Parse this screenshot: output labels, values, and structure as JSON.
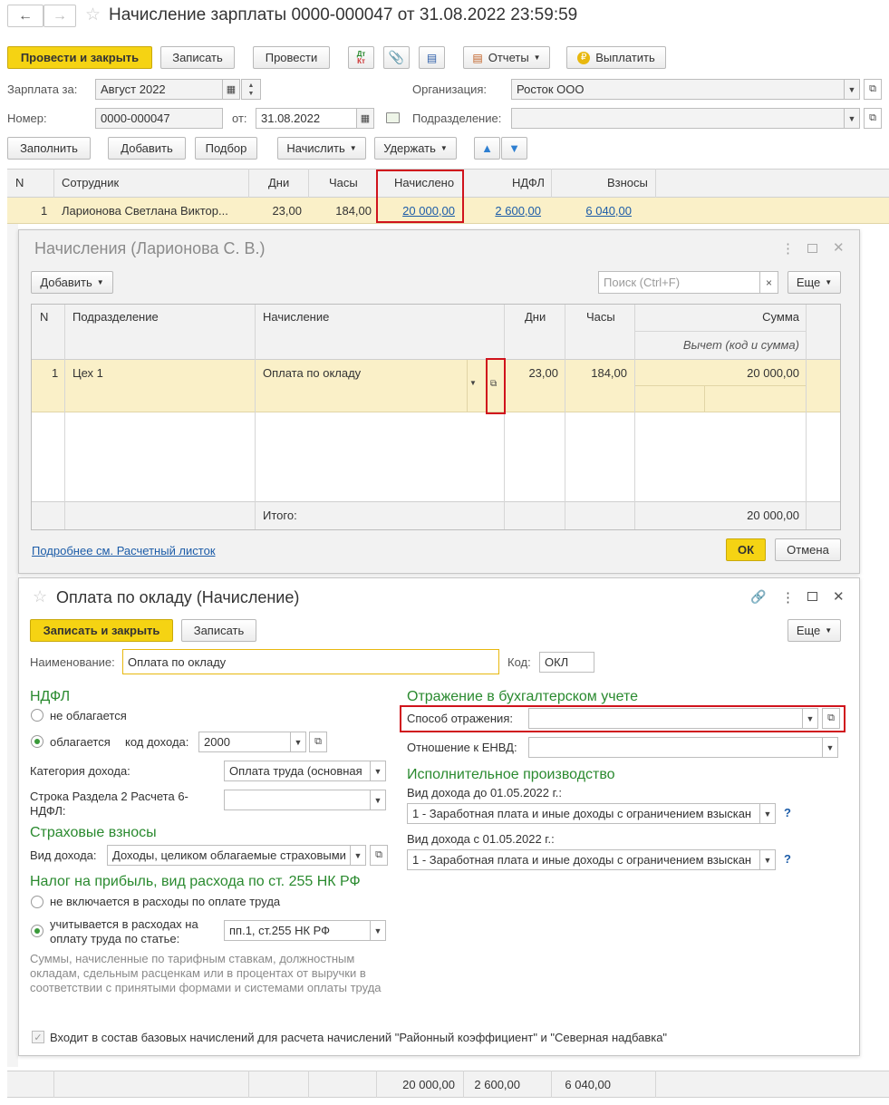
{
  "doc": {
    "title": "Начисление зарплаты 0000-000047 от 31.08.2022 23:59:59",
    "toolbar": {
      "post_close": "Провести и закрыть",
      "save": "Записать",
      "post": "Провести",
      "dtkt": "Дт Кт",
      "reports": "Отчеты",
      "pay": "Выплатить"
    },
    "salary_for_label": "Зарплата за:",
    "salary_for_value": "Август 2022",
    "org_label": "Организация:",
    "org_value": "Росток ООО",
    "number_label": "Номер:",
    "number_value": "0000-000047",
    "date_label": "от:",
    "date_value": "31.08.2022",
    "dept_label": "Подразделение:",
    "dept_value": "",
    "actions": {
      "fill": "Заполнить",
      "add": "Добавить",
      "select": "Подбор",
      "accrue": "Начислить",
      "withhold": "Удержать"
    },
    "table": {
      "headers": [
        "N",
        "Сотрудник",
        "Дни",
        "Часы",
        "Начислено",
        "НДФЛ",
        "Взносы"
      ],
      "row": {
        "n": "1",
        "employee": "Ларионова Светлана Виктор...",
        "days": "23,00",
        "hours": "184,00",
        "accrued": "20 000,00",
        "ndfl": "2 600,00",
        "contrib": "6 040,00"
      }
    },
    "footer": {
      "accrued": "20 000,00",
      "ndfl": "2 600,00",
      "contrib": "6 040,00"
    }
  },
  "accruals": {
    "title": "Начисления (Ларионова С. В.)",
    "add": "Добавить",
    "search_placeholder": "Поиск (Ctrl+F)",
    "more": "Еще",
    "headers": {
      "n": "N",
      "dept": "Подразделение",
      "accrual": "Начисление",
      "days": "Дни",
      "hours": "Часы",
      "sum": "Сумма",
      "deduction": "Вычет (код и сумма)"
    },
    "row": {
      "n": "1",
      "dept": "Цех 1",
      "accrual": "Оплата по окладу",
      "days": "23,00",
      "hours": "184,00",
      "sum": "20 000,00"
    },
    "total_label": "Итого:",
    "total_value": "20 000,00",
    "payslip_link": "Подробнее см. Расчетный листок",
    "ok": "ОК",
    "cancel": "Отмена"
  },
  "form": {
    "title": "Оплата по окладу (Начисление)",
    "save_close": "Записать и закрыть",
    "save": "Записать",
    "more": "Еще",
    "name_label": "Наименование:",
    "name_value": "Оплата по окладу",
    "code_label": "Код:",
    "code_value": "ОКЛ",
    "ndfl_header": "НДФЛ",
    "ndfl_not_taxed": "не облагается",
    "ndfl_taxed": "облагается",
    "income_code_label": "код дохода:",
    "income_code_value": "2000",
    "income_category_label": "Категория дохода:",
    "income_category_value": "Оплата труда (основная",
    "line6_label_1": "Строка Раздела 2 Расчета 6-",
    "line6_label_2": "НДФЛ:",
    "insurance_header": "Страховые взносы",
    "income_type_label": "Вид дохода:",
    "income_type_value": "Доходы, целиком облагаемые страховыми",
    "profit_tax_header": "Налог на прибыль, вид расхода по ст. 255 НК РФ",
    "not_included": "не включается в расходы по оплате труда",
    "included_1": "учитывается в расходах на",
    "included_2": "оплату труда по статье:",
    "article_value": "пп.1, ст.255 НК РФ",
    "note": "Суммы, начисленные по тарифным ставкам, должностным окладам, сдельным расценкам или в процентах от выручки в соответствии с принятыми формами и системами оплаты труда",
    "base_checkbox": "Входит в состав базовых начислений для расчета начислений \"Районный коэффициент\" и \"Северная надбавка\"",
    "accounting_header": "Отражение в бухгалтерском учете",
    "reflection_label": "Способ отражения:",
    "reflection_value": "",
    "envd_label": "Отношение к ЕНВД:",
    "envd_value": "",
    "enforcement_header": "Исполнительное производство",
    "before_label": "Вид дохода до 01.05.2022 г.:",
    "before_value": "1 - Заработная плата и иные доходы с ограничением взыскан",
    "after_label": "Вид дохода с 01.05.2022 г.:",
    "after_value": "1 - Заработная плата и иные доходы с ограничением взыскан",
    "help": "?"
  }
}
